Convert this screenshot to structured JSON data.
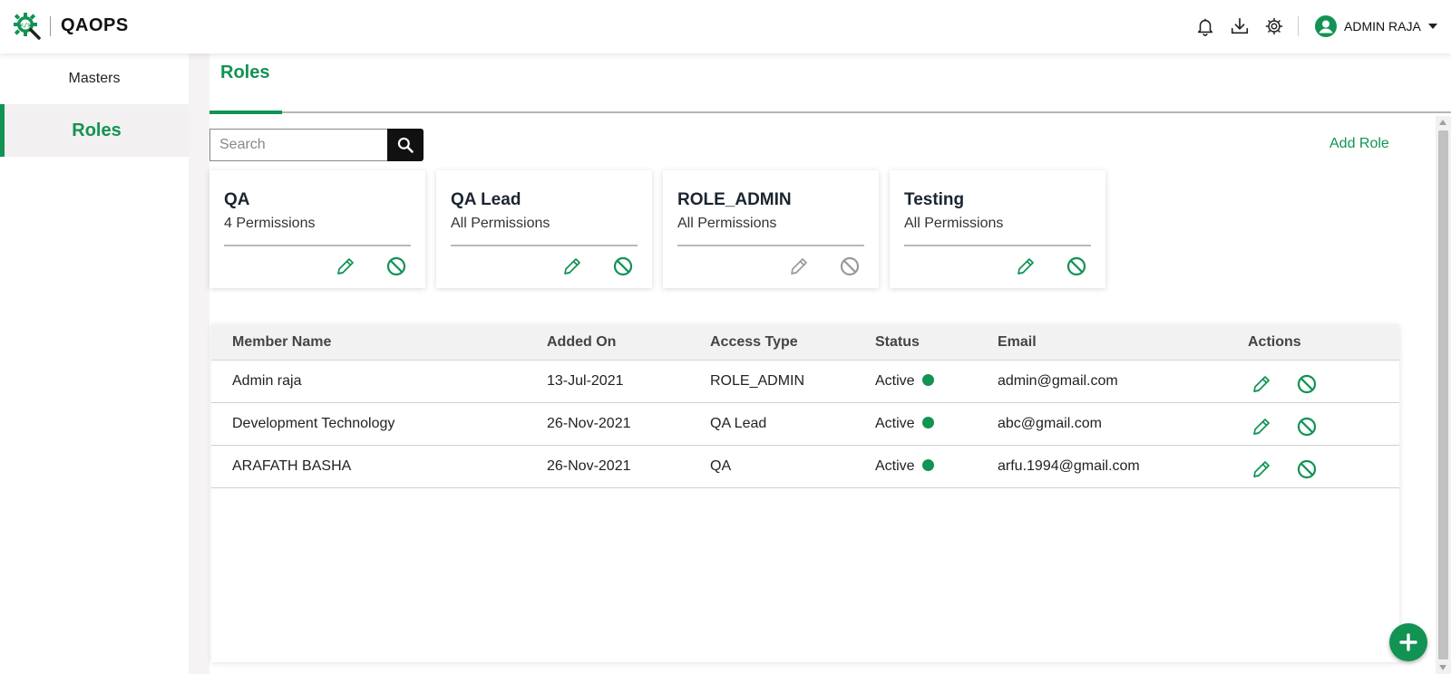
{
  "app": {
    "brand": "QAOPS",
    "logo_icon": "gear-code-magnifier-icon"
  },
  "header": {
    "icons": [
      "bell-icon",
      "download-icon",
      "settings-icon"
    ],
    "user_name": "ADMIN RAJA"
  },
  "sidebar": {
    "items": [
      {
        "label": "Masters",
        "active": false
      },
      {
        "label": "Roles",
        "active": true
      }
    ]
  },
  "main": {
    "tab": "Roles",
    "search_placeholder": "Search",
    "add_role_label": "Add Role",
    "role_cards": [
      {
        "title": "QA",
        "subtitle": "4 Permissions",
        "actions_enabled": true
      },
      {
        "title": "QA Lead",
        "subtitle": "All Permissions",
        "actions_enabled": true
      },
      {
        "title": "ROLE_ADMIN",
        "subtitle": "All Permissions",
        "actions_enabled": false
      },
      {
        "title": "Testing",
        "subtitle": "All Permissions",
        "actions_enabled": true
      }
    ],
    "table": {
      "columns": [
        "Member Name",
        "Added On",
        "Access Type",
        "Status",
        "Email",
        "Actions"
      ],
      "rows": [
        {
          "name": "Admin raja",
          "added_on": "13-Jul-2021",
          "access_type": "ROLE_ADMIN",
          "status": "Active",
          "email": "admin@gmail.com"
        },
        {
          "name": "Development Technology",
          "added_on": "26-Nov-2021",
          "access_type": "QA Lead",
          "status": "Active",
          "email": "abc@gmail.com"
        },
        {
          "name": "ARAFATH BASHA",
          "added_on": "26-Nov-2021",
          "access_type": "QA",
          "status": "Active",
          "email": "arfu.1994@gmail.com"
        }
      ]
    }
  },
  "colors": {
    "accent": "#119354",
    "disabled": "#9a9a9a",
    "status_active": "#119354"
  }
}
